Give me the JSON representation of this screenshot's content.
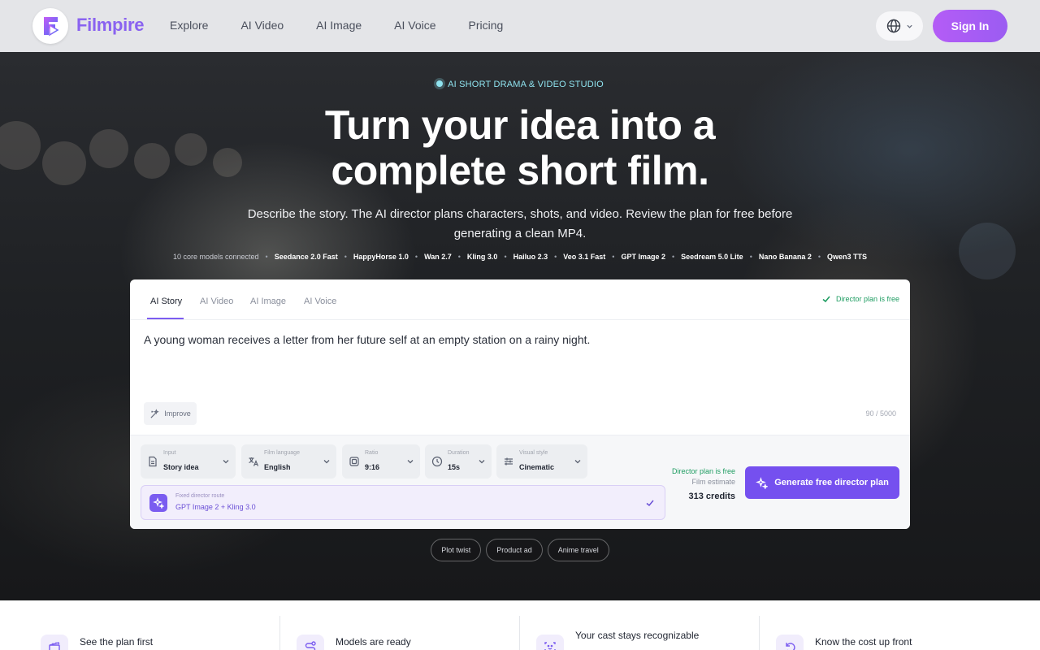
{
  "app": {
    "name": "Filmpire"
  },
  "nav": {
    "links": [
      "Explore",
      "AI Video",
      "AI Image",
      "AI Voice",
      "Pricing"
    ],
    "sign_in": "Sign In"
  },
  "hero": {
    "eyebrow": "AI SHORT DRAMA & VIDEO STUDIO",
    "headline_line1": "Turn your idea into a",
    "headline_line2": "complete short film.",
    "subline": "Describe the story. The AI director plans characters, shots, and video. Review the plan for free before generating a clean MP4.",
    "models_label": "10 core models connected",
    "models": [
      "Seedance 2.0 Fast",
      "HappyHorse 1.0",
      "Wan 2.7",
      "Kling 3.0",
      "Hailuo 2.3",
      "Veo 3.1 Fast",
      "GPT Image 2",
      "Seedream 5.0 Lite",
      "Nano Banana 2",
      "Qwen3 TTS"
    ]
  },
  "composer": {
    "tabs": [
      "AI Story",
      "AI Video",
      "AI Image",
      "AI Voice"
    ],
    "active_tab": "AI Story",
    "plan_free_badge": "Director plan is free",
    "prompt_value": "A young woman receives a letter from her future self at an empty station on a rainy night.",
    "improve_label": "Improve",
    "char_count": "90 / 5000",
    "controls": {
      "input": {
        "caption": "Input",
        "value": "Story idea"
      },
      "language": {
        "caption": "Film language",
        "value": "English"
      },
      "ratio": {
        "caption": "Ratio",
        "value": "9:16"
      },
      "duration": {
        "caption": "Duration",
        "value": "15s"
      },
      "style": {
        "caption": "Visual style",
        "value": "Cinematic"
      }
    },
    "route": {
      "caption": "Fixed director route",
      "value": "GPT Image 2 + Kling 3.0"
    },
    "estimate": {
      "free_note": "Director plan is free",
      "caption": "Film estimate",
      "value": "313 credits"
    },
    "generate_label": "Generate free director plan"
  },
  "chips": [
    "Plot twist",
    "Product ad",
    "Anime travel"
  ],
  "features": [
    {
      "title": "See the plan first",
      "icon": "clapper-icon"
    },
    {
      "title": "Models are ready",
      "icon": "route-icon"
    },
    {
      "title": "Your cast stays recognizable",
      "icon": "face-scan-icon"
    },
    {
      "title": "Know the cost up front",
      "icon": "undo-icon"
    }
  ],
  "colors": {
    "brand": "#8a63f0",
    "accent": "#7550ef",
    "success": "#1f9d62",
    "eyebrow": "#8fe3ef"
  }
}
